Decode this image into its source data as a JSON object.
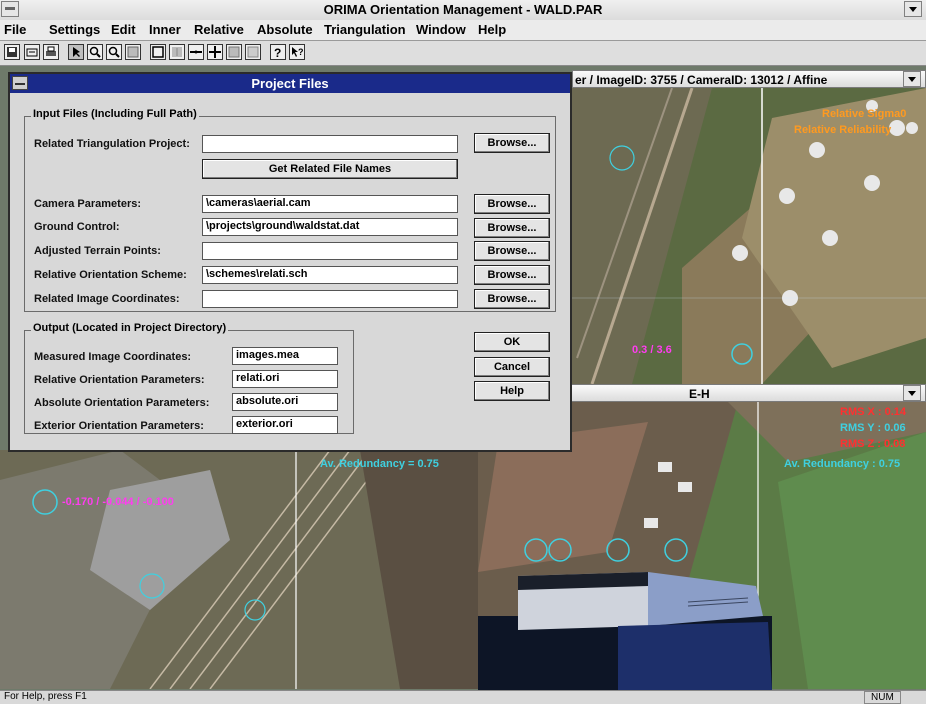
{
  "window": {
    "title": "ORIMA Orientation Management - WALD.PAR"
  },
  "menu": [
    "File",
    "Settings",
    "Edit",
    "Inner",
    "Relative",
    "Absolute",
    "Triangulation",
    "Window",
    "Help"
  ],
  "toolbar": {
    "icons": [
      "save-icon",
      "printer-setup-icon",
      "print-icon",
      "pointer-icon",
      "zoom-in-icon",
      "zoom-out-icon",
      "measure-icon",
      "select-box-icon",
      "point-icon",
      "crosshair-icon",
      "grid-icon",
      "frame-icon",
      "help-icon",
      "context-help-icon"
    ]
  },
  "panes": {
    "top_right_title": "er / ImageID: 3755 / CameraID: 13012 / Affine",
    "bottom_right_title": "E-H",
    "top_right_overlays": [
      "Relative Sigma0",
      "Relative Reliability"
    ],
    "top_right_point_label": "0.3 / 3.6",
    "bottom_left_overlay": "Av. Redundancy = 0.75",
    "bottom_left_coords": "-0.170 / -0.044 / -0.100",
    "bottom_right_overlays": [
      "RMS X : 0.14",
      "RMS Y : 0.06",
      "RMS Z : 0.08",
      "Av. Redundancy : 0.75"
    ]
  },
  "dialog": {
    "title": "Project Files",
    "input_group_label": "Input Files (Including Full Path)",
    "related_triangulation_label": "Related Triangulation Project:",
    "related_triangulation_value": "",
    "get_related_button": "Get Related File Names",
    "browse_label": "Browse...",
    "inputs": [
      {
        "label": "Camera Parameters:",
        "value": "\\cameras\\aerial.cam"
      },
      {
        "label": "Ground Control:",
        "value": "\\projects\\ground\\waldstat.dat"
      },
      {
        "label": "Adjusted Terrain Points:",
        "value": ""
      },
      {
        "label": "Relative Orientation Scheme:",
        "value": "\\schemes\\relati.sch"
      },
      {
        "label": "Related Image Coordinates:",
        "value": ""
      }
    ],
    "output_group_label": "Output (Located in Project Directory)",
    "outputs": [
      {
        "label": "Measured Image Coordinates:",
        "value": "images.mea"
      },
      {
        "label": "Relative Orientation Parameters:",
        "value": "relati.ori"
      },
      {
        "label": "Absolute Orientation Parameters:",
        "value": "absolute.ori"
      },
      {
        "label": "Exterior Orientation Parameters:",
        "value": "exterior.ori"
      }
    ],
    "ok": "OK",
    "cancel": "Cancel",
    "help": "Help"
  },
  "status": {
    "help_text": "For Help, press F1",
    "num": "NUM"
  },
  "colors": {
    "dialog_title_bar": "#1a2a8a",
    "overlay_cyan": "#3fd0e0",
    "overlay_red": "#ff3030",
    "overlay_orange": "#ff9a20",
    "overlay_magenta": "#ff3cf0"
  }
}
